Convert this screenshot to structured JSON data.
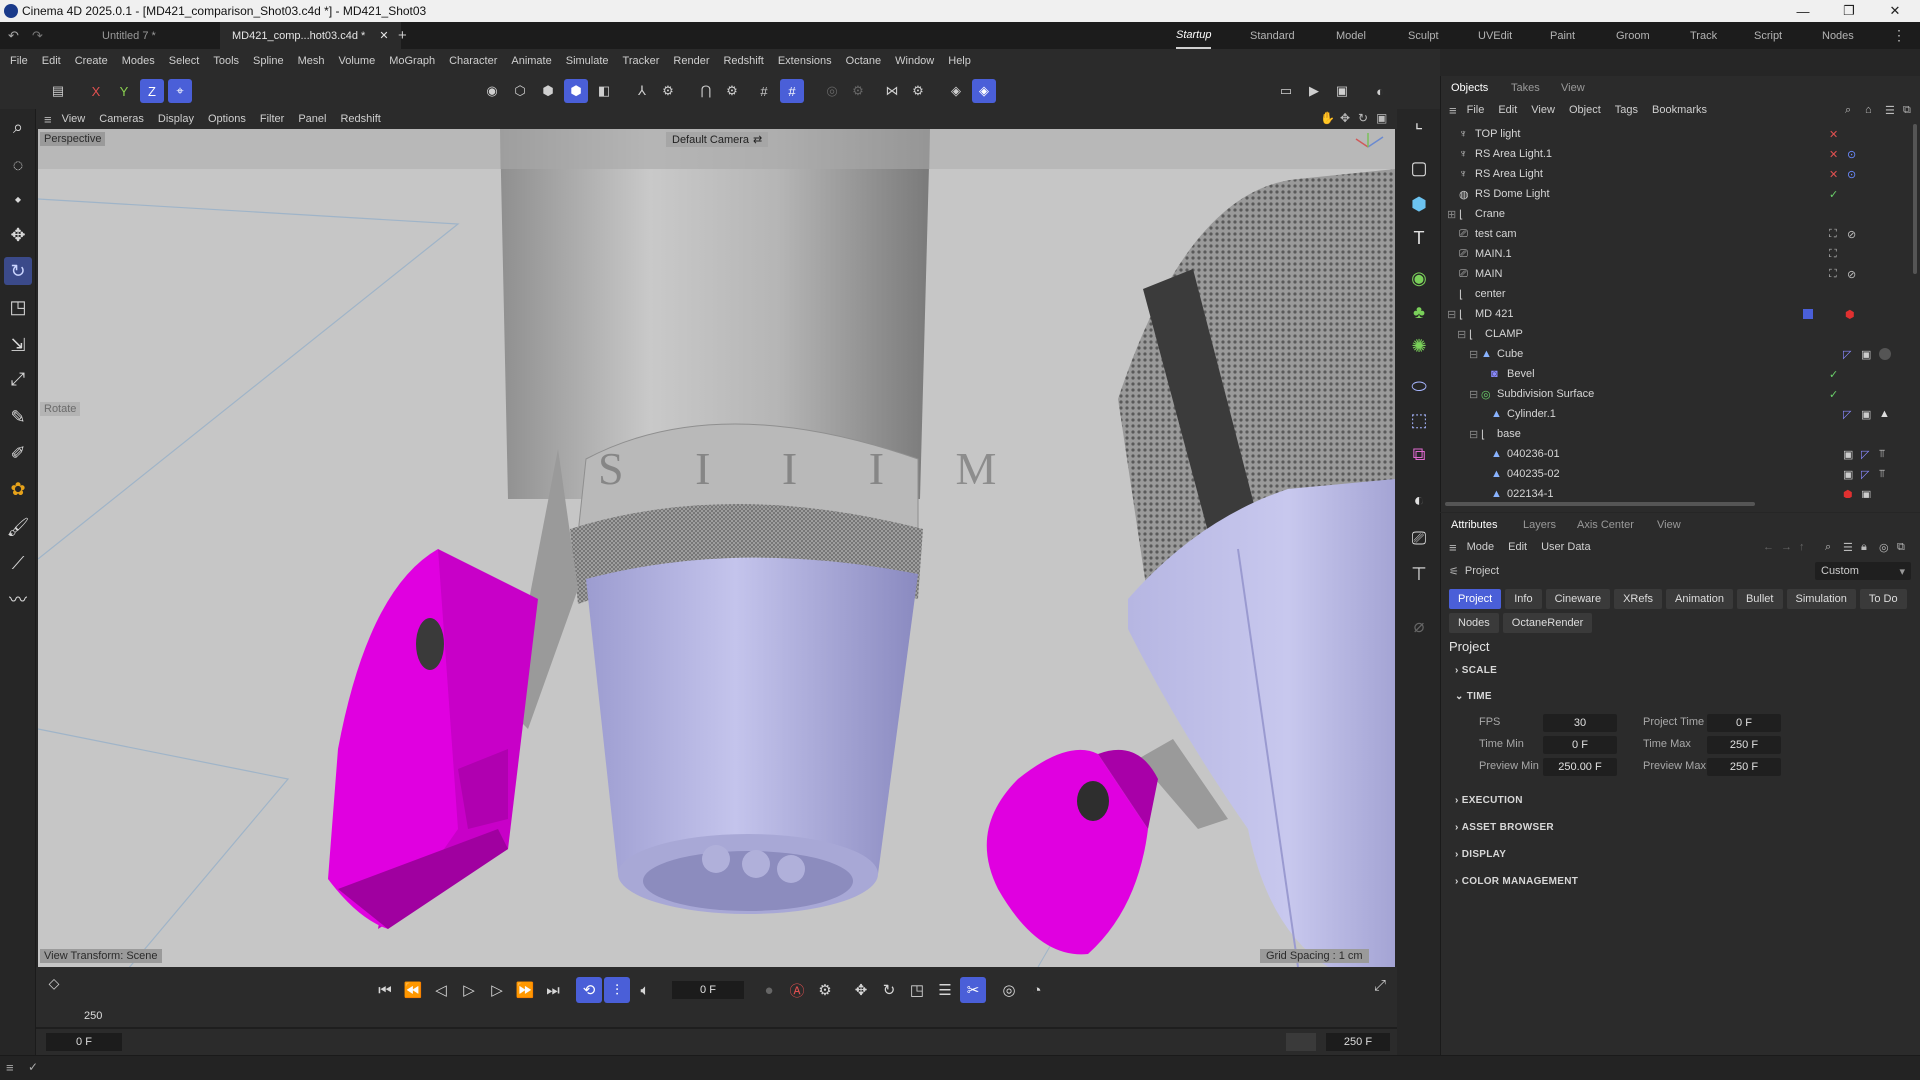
{
  "window": {
    "title": "Cinema 4D 2025.0.1 - [MD421_comparison_Shot03.c4d *] - MD421_Shot03"
  },
  "doc_tabs": [
    {
      "label": "Untitled 7 *"
    },
    {
      "label": "MD421_comp...hot03.c4d *"
    }
  ],
  "layouts": [
    "Startup",
    "Standard",
    "Model",
    "Sculpt",
    "UVEdit",
    "Paint",
    "Groom",
    "Track",
    "Script",
    "Nodes"
  ],
  "menus": [
    "File",
    "Edit",
    "Create",
    "Modes",
    "Select",
    "Tools",
    "Spline",
    "Mesh",
    "Volume",
    "MoGraph",
    "Character",
    "Animate",
    "Simulate",
    "Tracker",
    "Render",
    "Redshift",
    "Extensions",
    "Octane",
    "Window",
    "Help"
  ],
  "axis": {
    "x": "X",
    "y": "Y",
    "z": "Z"
  },
  "viewport": {
    "menus": [
      "View",
      "Cameras",
      "Display",
      "Options",
      "Filter",
      "Panel",
      "Redshift"
    ],
    "label": "Perspective",
    "camera": "Default Camera",
    "tool_tag": "Rotate",
    "transform": "View Transform: Scene",
    "grid": "Grid Spacing : 1 cm",
    "engraving": "S I I I M"
  },
  "timeline": {
    "current_frame": "0 F",
    "marker": "250",
    "start": "0 F",
    "end": "250 F"
  },
  "objects_panel": {
    "tabs": [
      "Objects",
      "Takes",
      "View"
    ],
    "menus": [
      "File",
      "Edit",
      "View",
      "Object",
      "Tags",
      "Bookmarks"
    ],
    "items": [
      {
        "name": "TOP light"
      },
      {
        "name": "RS Area Light.1"
      },
      {
        "name": "RS Area Light"
      },
      {
        "name": "RS Dome Light"
      },
      {
        "name": "Crane"
      },
      {
        "name": "test cam"
      },
      {
        "name": "MAIN.1"
      },
      {
        "name": "MAIN"
      },
      {
        "name": "center"
      },
      {
        "name": "MD 421"
      },
      {
        "name": "CLAMP"
      },
      {
        "name": "Cube"
      },
      {
        "name": "Bevel"
      },
      {
        "name": "Subdivision Surface"
      },
      {
        "name": "Cylinder.1"
      },
      {
        "name": "base"
      },
      {
        "name": "040236-01"
      },
      {
        "name": "040235-02"
      },
      {
        "name": "022134-1"
      }
    ]
  },
  "attributes_panel": {
    "tabs": [
      "Attributes",
      "Layers",
      "Axis Center",
      "View"
    ],
    "menus": [
      "Mode",
      "Edit",
      "User Data"
    ],
    "crumb": "Project",
    "preset": "Custom",
    "subtabs": [
      "Project",
      "Info",
      "Cineware",
      "XRefs",
      "Animation",
      "Bullet",
      "Simulation",
      "To Do",
      "Nodes",
      "OctaneRender"
    ],
    "heading": "Project",
    "sections": {
      "scale": "SCALE",
      "time": "TIME",
      "execution": "EXECUTION",
      "asset_browser": "ASSET BROWSER",
      "display": "DISPLAY",
      "color_management": "COLOR MANAGEMENT"
    },
    "fields": {
      "fps_label": "FPS",
      "fps": "30",
      "project_time_label": "Project Time",
      "project_time": "0 F",
      "time_min_label": "Time Min",
      "time_min": "0 F",
      "time_max_label": "Time Max",
      "time_max": "250 F",
      "preview_min_label": "Preview Min",
      "preview_min": "250.00 F",
      "preview_max_label": "Preview Max",
      "preview_max": "250 F"
    }
  },
  "colors": {
    "accent": "#4a5fd8",
    "magenta": "#d400d4",
    "lavender": "#b8b8e8"
  }
}
